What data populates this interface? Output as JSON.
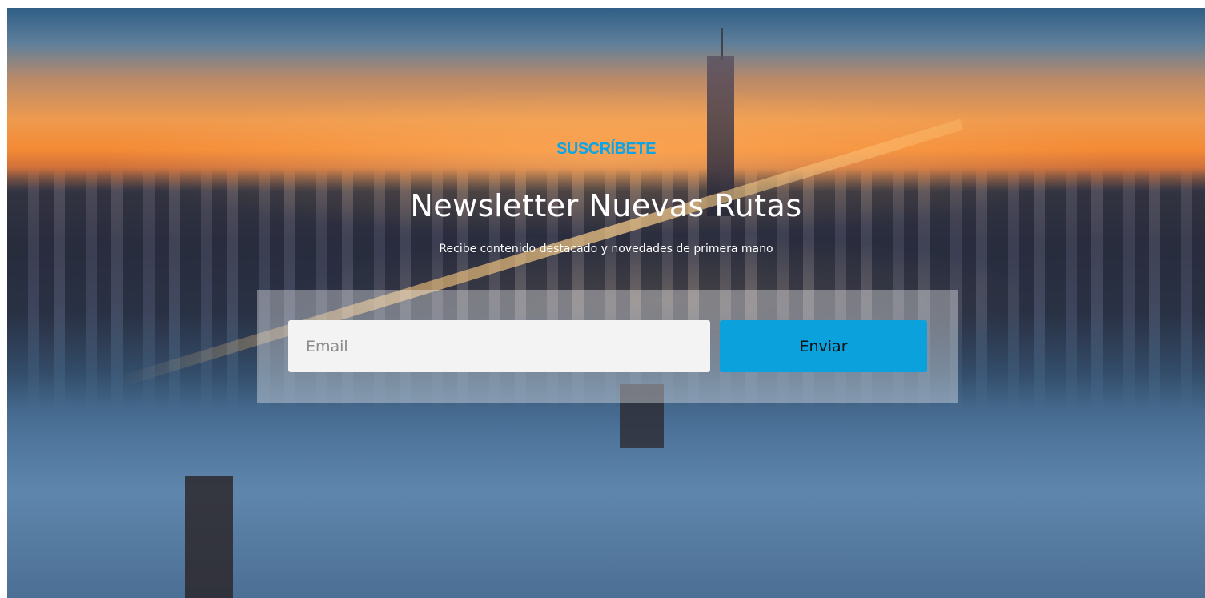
{
  "newsletter": {
    "eyebrow": "SUSCRÍBETE",
    "title": "Newsletter Nuevas Rutas",
    "subtitle": "Recibe contenido destacado y novedades de primera mano",
    "email_placeholder": "Email",
    "email_value": "",
    "submit_label": "Enviar"
  },
  "colors": {
    "accent": "#0aa1dd",
    "eyebrow": "#0ca4e6",
    "input_bg": "#f3f3f3",
    "heading_text": "#ffffff"
  }
}
